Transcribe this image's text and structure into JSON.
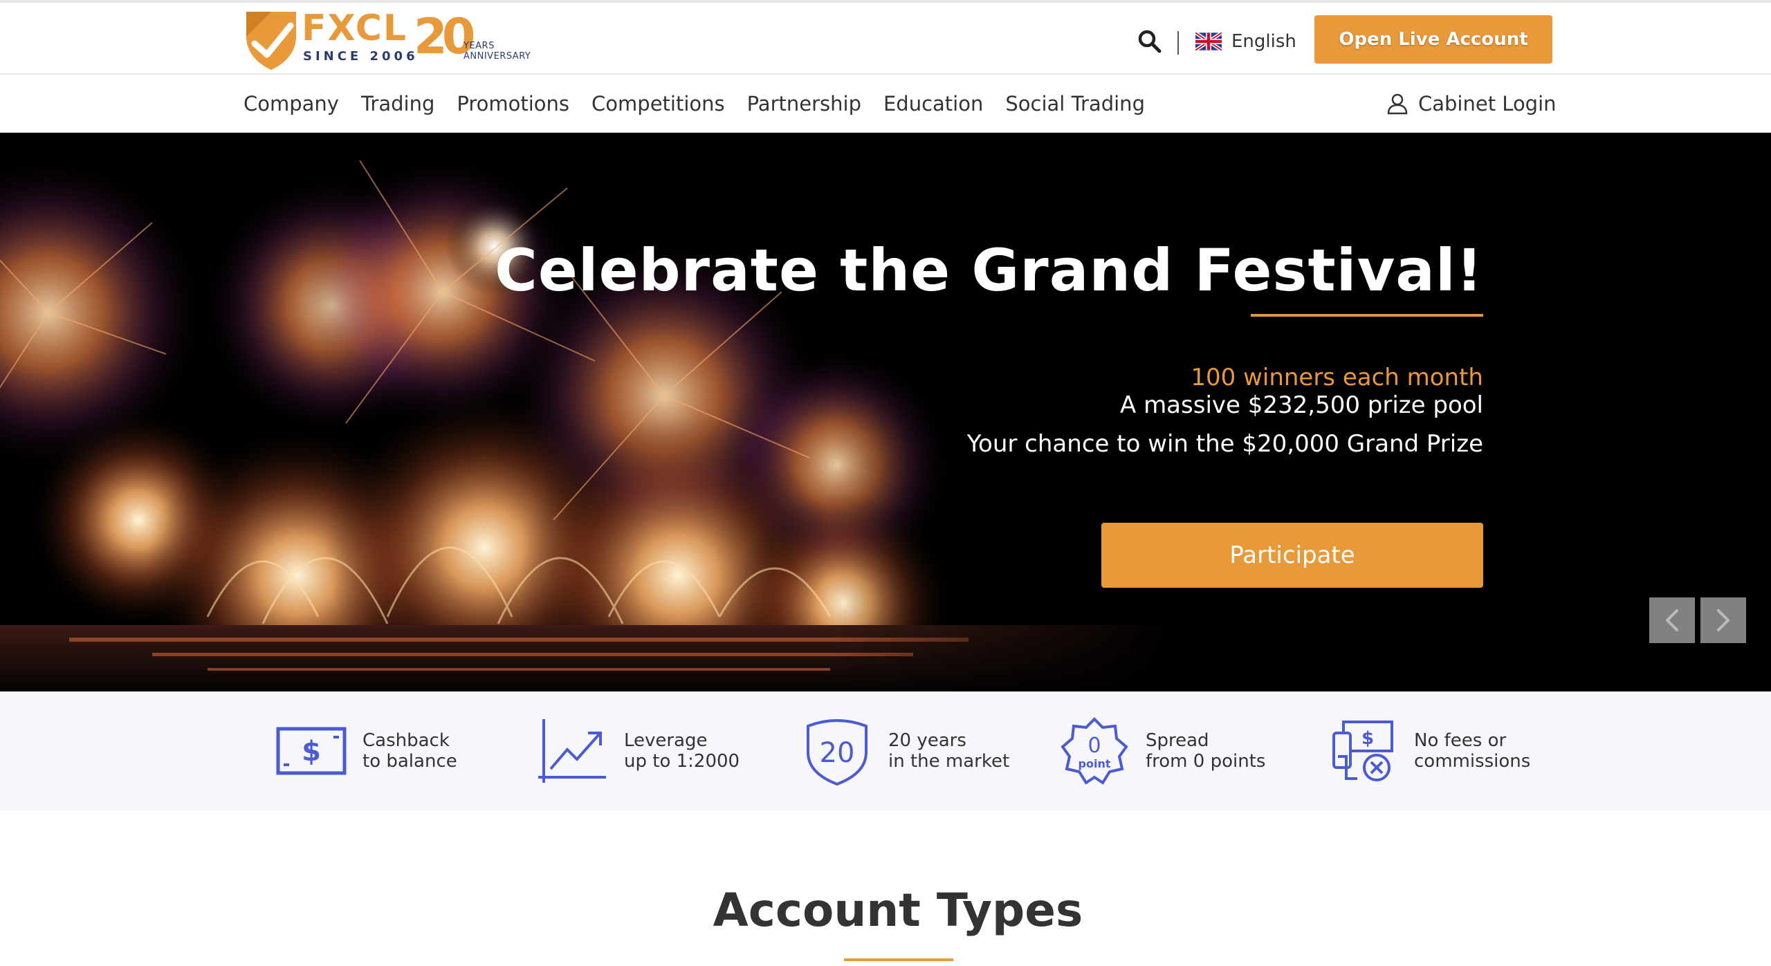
{
  "header": {
    "brand": "FXCL",
    "since": "SINCE 2006",
    "anniversary_number": "20",
    "anniversary_text_1": "YEARS",
    "anniversary_text_2": "ANNIVERSARY",
    "search_icon": "search-icon",
    "language": "English",
    "language_flag_icon": "uk-flag-icon",
    "open_live_label": "Open Live Account"
  },
  "nav": {
    "items": [
      {
        "label": "Company"
      },
      {
        "label": "Trading"
      },
      {
        "label": "Promotions"
      },
      {
        "label": "Competitions"
      },
      {
        "label": "Partnership"
      },
      {
        "label": "Education"
      },
      {
        "label": "Social Trading"
      }
    ],
    "cabinet_label": "Cabinet Login",
    "cabinet_icon": "user-icon"
  },
  "hero": {
    "title": "Celebrate the Grand Festival!",
    "line1": "100 winners each month",
    "line2": "A massive $232,500 prize pool",
    "line3": "Your chance to win the $20,000 Grand Prize",
    "cta_label": "Participate",
    "prev_icon": "chevron-left-icon",
    "next_icon": "chevron-right-icon"
  },
  "features": [
    {
      "line1": "Cashback",
      "line2": "to balance",
      "icon": "dollar-bill-icon"
    },
    {
      "line1": "Leverage",
      "line2": "up to 1:2000",
      "icon": "trend-chart-icon"
    },
    {
      "line1": "20 years",
      "line2": "in the market",
      "icon": "shield-20-icon",
      "icon_text": "20"
    },
    {
      "line1": "Spread",
      "line2": "from 0 points",
      "icon": "zero-point-badge-icon",
      "icon_text": "0",
      "icon_subtext": "point"
    },
    {
      "line1": "No fees or",
      "line2": "commissions",
      "icon": "no-fee-icon"
    }
  ],
  "account_types": {
    "title": "Account Types"
  },
  "colors": {
    "accent": "#e8993a",
    "navy": "#2b3b6e",
    "icon_blue": "#4a5bd4",
    "hero_bg": "#000000",
    "features_bg": "#f7f7fb"
  }
}
